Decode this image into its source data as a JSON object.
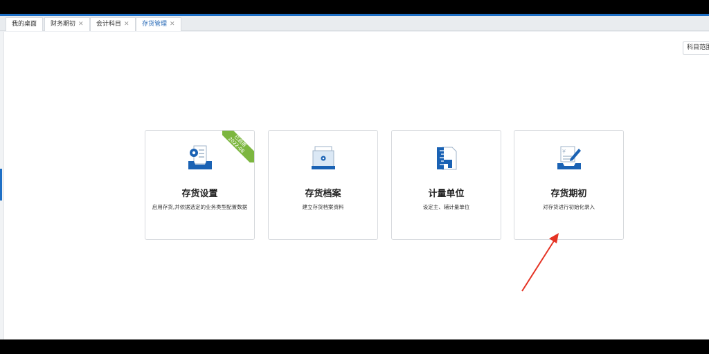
{
  "tabs": [
    {
      "label": "我的桌面",
      "closable": false,
      "active": false
    },
    {
      "label": "财务期初",
      "closable": true,
      "active": false
    },
    {
      "label": "会计科目",
      "closable": true,
      "active": false
    },
    {
      "label": "存货管理",
      "closable": true,
      "active": true
    }
  ],
  "toolbar": {
    "range_label": "科目范围"
  },
  "cards": [
    {
      "title": "存货设置",
      "desc": "启用存货,并依据选定的业务类型配置数据",
      "ribbon_line1": "已启用",
      "ribbon_line2": "2022-08"
    },
    {
      "title": "存货档案",
      "desc": "建立存货档案资料"
    },
    {
      "title": "计量单位",
      "desc": "设定主、辅计量单位"
    },
    {
      "title": "存货期初",
      "desc": "对存货进行初始化录入"
    }
  ],
  "colors": {
    "accent": "#1e6fc5",
    "ribbon": "#7cb63f",
    "annotation_arrow": "#e53324"
  }
}
